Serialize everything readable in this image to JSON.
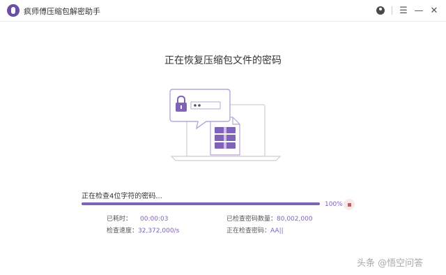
{
  "window": {
    "title": "疯师傅压缩包解密助手"
  },
  "titlebar_icons": {
    "user": "user-icon",
    "menu": "menu-icon",
    "minimize": "minimize-icon",
    "close": "close-icon",
    "menu_glyph": "☰",
    "minimize_glyph": "—",
    "close_glyph": "✕"
  },
  "main": {
    "heading": "正在恢复压缩包文件的密码",
    "status_text": "正在检查4位字符的密码...",
    "progress": {
      "value": 100,
      "label": "100%"
    },
    "stats": {
      "elapsed_label": "已耗时：",
      "elapsed_value": "00:00:03",
      "checked_label": "已检查密码数量：",
      "checked_value": "80,002,000",
      "speed_label": "检查速度：",
      "speed_value": "32,372,000/s",
      "current_label": "正在检查密码：",
      "current_value": "AA||"
    }
  },
  "watermark": "头条 @悟空问答",
  "colors": {
    "accent": "#7f63b8",
    "stop": "#d9534f"
  }
}
